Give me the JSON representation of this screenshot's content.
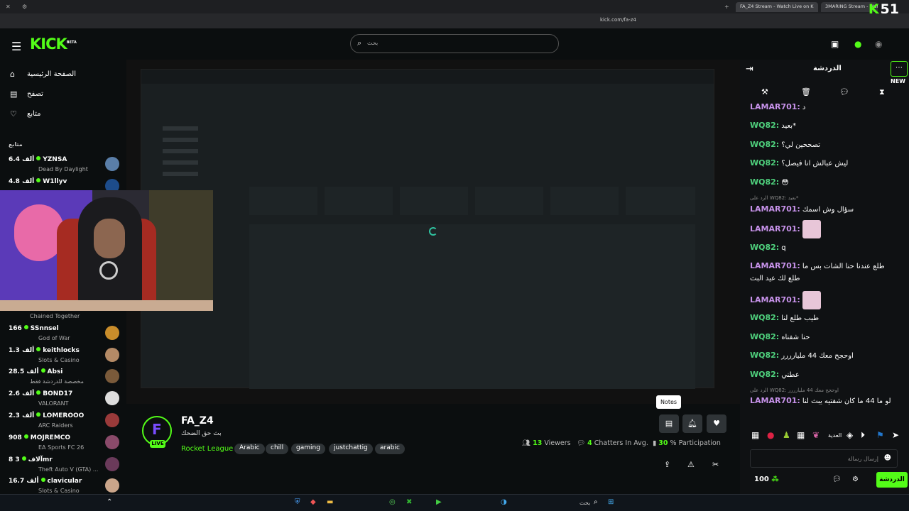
{
  "browser": {
    "tab_active": "FA_Z4 Stream - Watch Live on K",
    "tab_other": "3MARING Stream - Watc",
    "url": "kick.com/fa-z4",
    "badge_number": "51"
  },
  "header": {
    "logo": "KICK",
    "logo_beta": "BETA",
    "search_placeholder": "بحث"
  },
  "sidebar": {
    "nav": [
      {
        "label": "الصفحة الرئيسية",
        "icon": "home-icon"
      },
      {
        "label": "تصفح",
        "icon": "browse-icon"
      },
      {
        "label": "متابع",
        "icon": "heart-icon"
      }
    ],
    "following_title": "متابع",
    "channels": [
      {
        "viewers": "6.4 ألف",
        "name": "YZNSA",
        "category": "Dead By Daylight"
      },
      {
        "viewers": "4.8 ألف",
        "name": "W1llyv",
        "category": ""
      },
      {
        "viewers": "",
        "name": "",
        "category": "Chained Together"
      },
      {
        "viewers": "166",
        "name": "SSnnsel",
        "category": "God of War"
      },
      {
        "viewers": "1.3 ألف",
        "name": "keithlocks",
        "category": "Slots & Casino"
      },
      {
        "viewers": "28.5 ألف",
        "name": "Absi",
        "category": "مخصصة للدردشة فقط"
      },
      {
        "viewers": "2.6 ألف",
        "name": "BOND17",
        "category": "VALORANT"
      },
      {
        "viewers": "2.3 ألف",
        "name": "LOMEROOO",
        "category": "ARC Raiders"
      },
      {
        "viewers": "908",
        "name": "MOJREMCO",
        "category": "EA Sports FC 26"
      },
      {
        "viewers": "8 آلاف",
        "name": "3mr",
        "category": "Theft Auto V (GTA) ..."
      },
      {
        "viewers": "16.7 ألف",
        "name": "clavicular",
        "category": "Slots & Casino"
      }
    ]
  },
  "stream": {
    "streamer": "FA_Z4",
    "avatar_letter": "F",
    "live_label": "LIVE",
    "title": "بث حق الضحك",
    "category": "Rocket League",
    "tags": [
      "Arabic",
      "chill",
      "gaming",
      "justchattig",
      "arabic"
    ],
    "viewers": "13",
    "viewers_label": "Viewers",
    "chatters": "4",
    "chatters_label": "Chatters In Avg.",
    "participation": "30",
    "participation_label": "% Participation",
    "tooltip": "Notes"
  },
  "chat": {
    "title": "الدردشة",
    "new_label": "NEW",
    "messages": [
      {
        "user": "LAMAR701:",
        "color": "#c792ea",
        "text": "د"
      },
      {
        "user": "WQ82:",
        "color": "#4fd17d",
        "text": "بعيد*"
      },
      {
        "user": "WQ82:",
        "color": "#4fd17d",
        "text": "تصححين لي؟"
      },
      {
        "user": "WQ82:",
        "color": "#4fd17d",
        "text": "ليش عبالش انا فيصل؟"
      },
      {
        "user": "WQ82:",
        "color": "#4fd17d",
        "text": "😳"
      },
      {
        "user": "LAMAR701:",
        "color": "#c792ea",
        "text": "سؤال وش اسمك"
      },
      {
        "user": "LAMAR701:",
        "color": "#c792ea",
        "text": ""
      },
      {
        "user": "WQ82:",
        "color": "#4fd17d",
        "text": "q"
      },
      {
        "user": "LAMAR701:",
        "color": "#c792ea",
        "text": "طلع عندنا حنا الشات بس ما"
      },
      {
        "user": "",
        "color": "#c792ea",
        "text": "طلع لك عيد البث"
      },
      {
        "user": "LAMAR701:",
        "color": "#c792ea",
        "text": ""
      },
      {
        "user": "WQ82:",
        "color": "#4fd17d",
        "text": "طيب طلع لنا"
      },
      {
        "user": "WQ82:",
        "color": "#4fd17d",
        "text": "حنا شفناه"
      },
      {
        "user": "WQ82:",
        "color": "#4fd17d",
        "text": "اوحجح معك 44 مليارررر"
      },
      {
        "user": "WQ82:",
        "color": "#4fd17d",
        "text": "عطني"
      },
      {
        "user": "LAMAR701:",
        "color": "#c792ea",
        "text": "لو ما 44 ما كان شفتيه يبث لنا"
      }
    ],
    "reply1": "الرد على WQ82: بعيد*",
    "reply2": "الرد على WQ82: اوحجح معك 44 مليارررر",
    "input_placeholder": "إرسال رسالة",
    "points": "100",
    "send_label": "الدردشة",
    "emote_label": "العدية"
  },
  "taskbar": {
    "search_label": "بحث"
  }
}
